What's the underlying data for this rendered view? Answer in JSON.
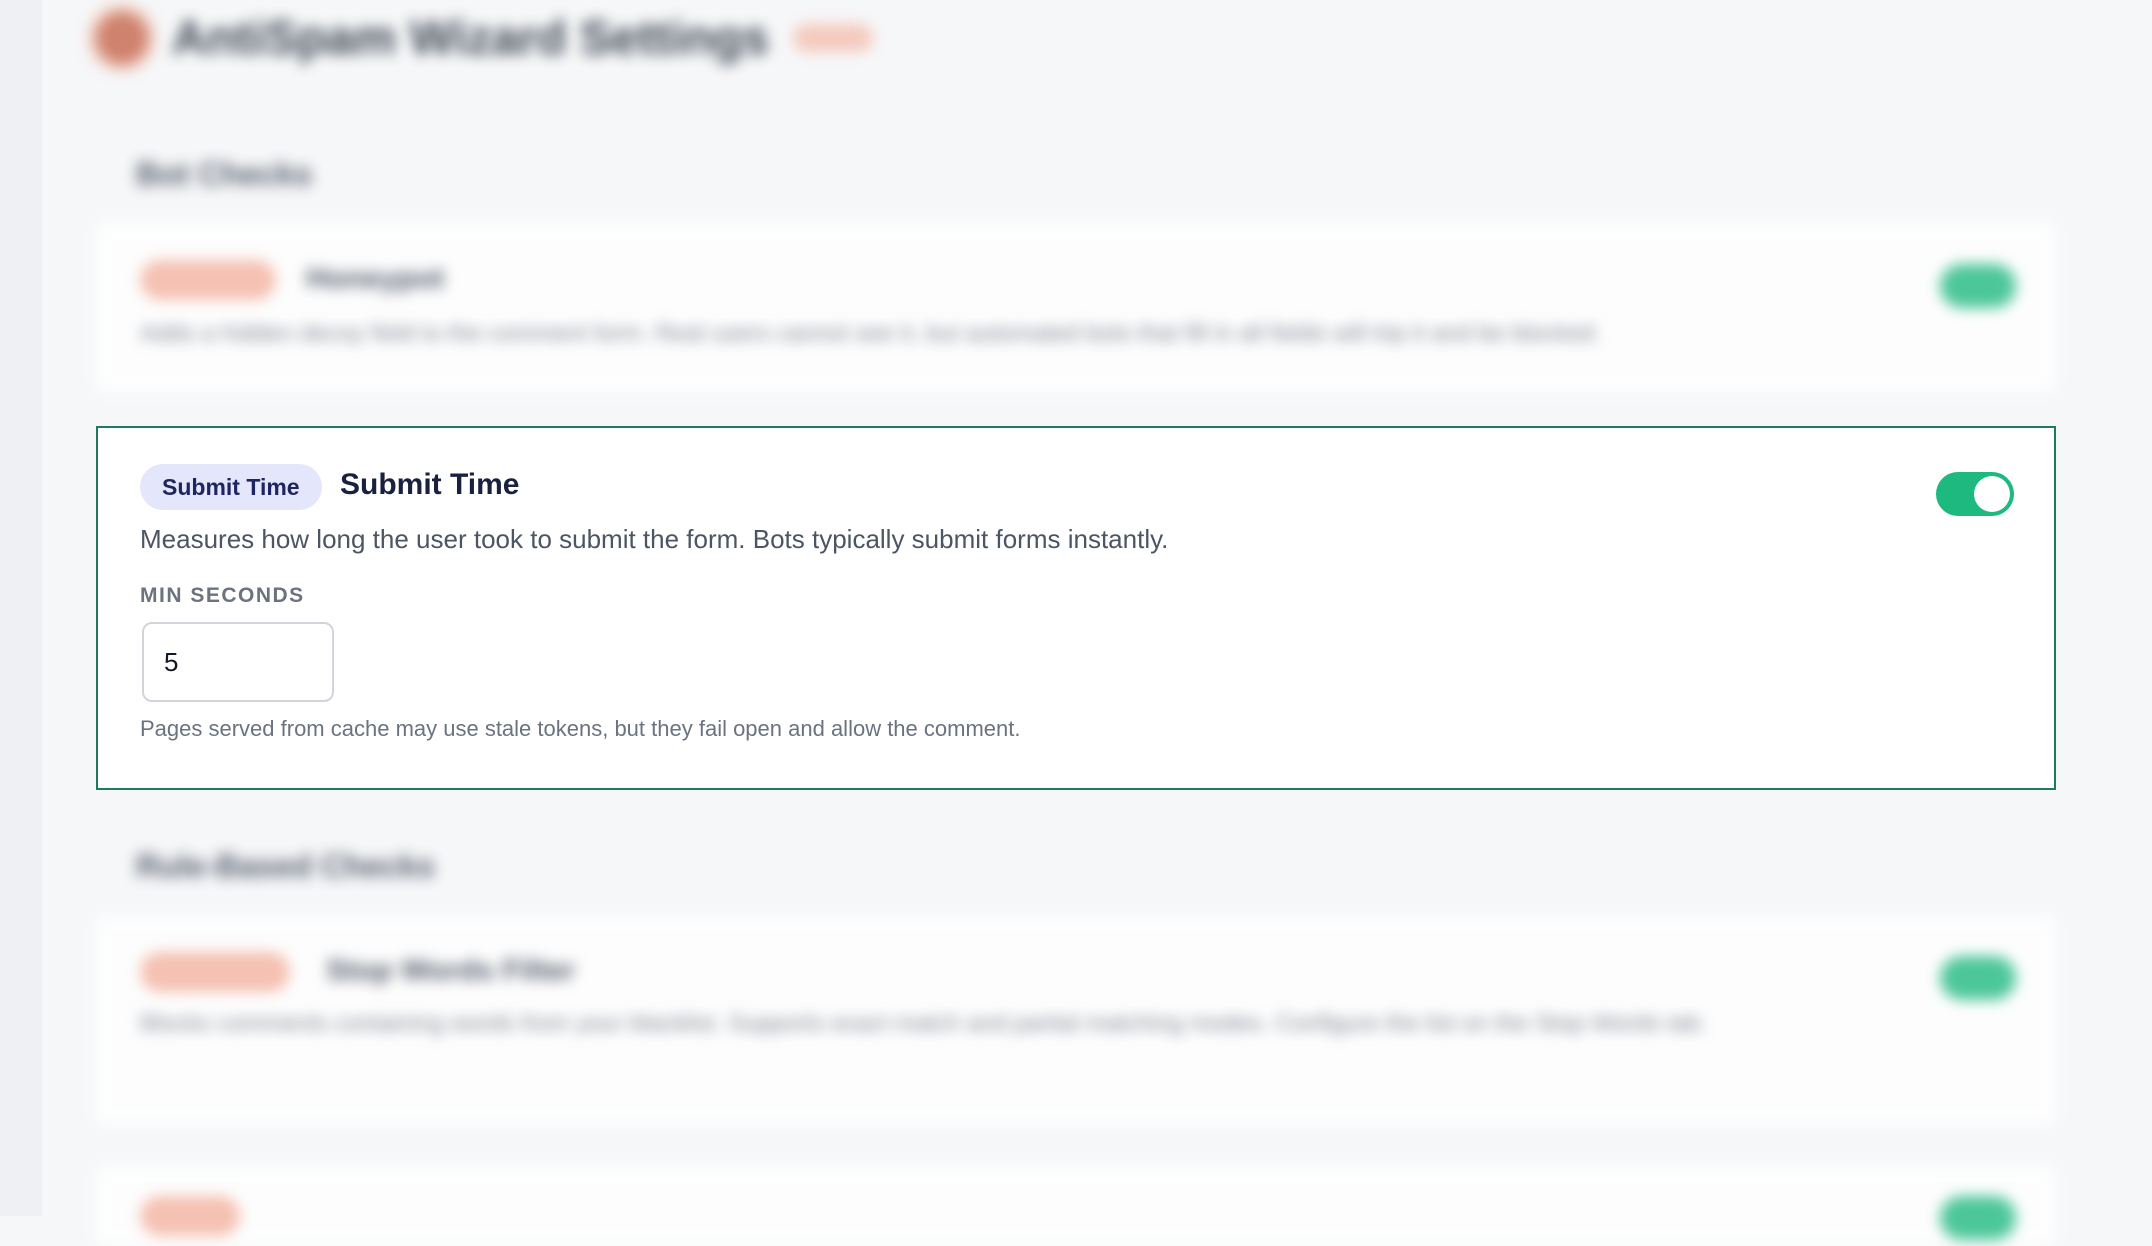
{
  "header": {
    "title": "AntiSpam Wizard Settings"
  },
  "sections": [
    {
      "heading": "Bot Checks"
    },
    {
      "heading": "Rule-Based Checks"
    }
  ],
  "blurred_cards": [
    {
      "name": "Honeypot",
      "description": "Adds a hidden decoy field to the comment form. Real users cannot see it, but automated bots that fill in all fields will trip it and be blocked."
    },
    {
      "name": "Stop Words Filter",
      "description": "Blocks comments containing words from your blacklist. Supports exact match and partial matching modes. Configure the list on the Stop Words tab."
    }
  ],
  "submit_time_card": {
    "badge": "Submit Time",
    "title": "Submit Time",
    "description": "Measures how long the user took to submit the form. Bots typically submit forms instantly.",
    "field_label": "MIN SECONDS",
    "min_seconds_value": "5",
    "help_text": "Pages served from cache may use stale tokens, but they fail open and allow the comment.",
    "enabled": true
  },
  "colors": {
    "accent_border": "#1f7a5c",
    "toggle_on": "#1db97e",
    "badge_bg": "#e4e7fb",
    "badge_text": "#1e2560"
  }
}
